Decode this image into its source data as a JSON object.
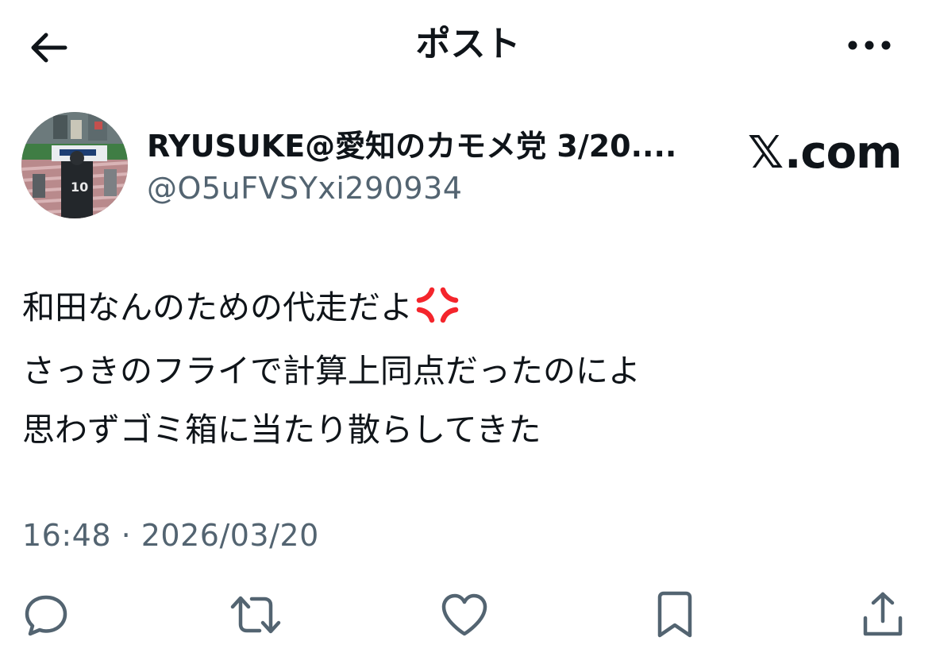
{
  "header": {
    "title": "ポスト",
    "back_icon": "arrow-left-icon",
    "more_icon": "more-horizontal-icon"
  },
  "author": {
    "display_name": "RYUSUKE@愛知のカモメ党 3/20....",
    "handle": "@O5uFVSYxi290934",
    "avatar_icon": "avatar"
  },
  "brand": {
    "x_glyph": "𝕏",
    "domain": ".com"
  },
  "post": {
    "lines": [
      "和田なんのための代走だよ",
      "さっきのフライで計算上同点だったのによ",
      "思わずゴミ箱に当たり散らしてきた"
    ],
    "emoji_icon": "anger-symbol-icon"
  },
  "timestamp": "16:48 · 2026/03/20",
  "actions": {
    "reply_icon": "reply-icon",
    "repost_icon": "repost-icon",
    "like_icon": "heart-icon",
    "bookmark_icon": "bookmark-icon",
    "share_icon": "share-icon"
  },
  "colors": {
    "text_primary": "#0f1419",
    "text_secondary": "#536471",
    "anger_red": "#f4252c",
    "background": "#ffffff"
  }
}
